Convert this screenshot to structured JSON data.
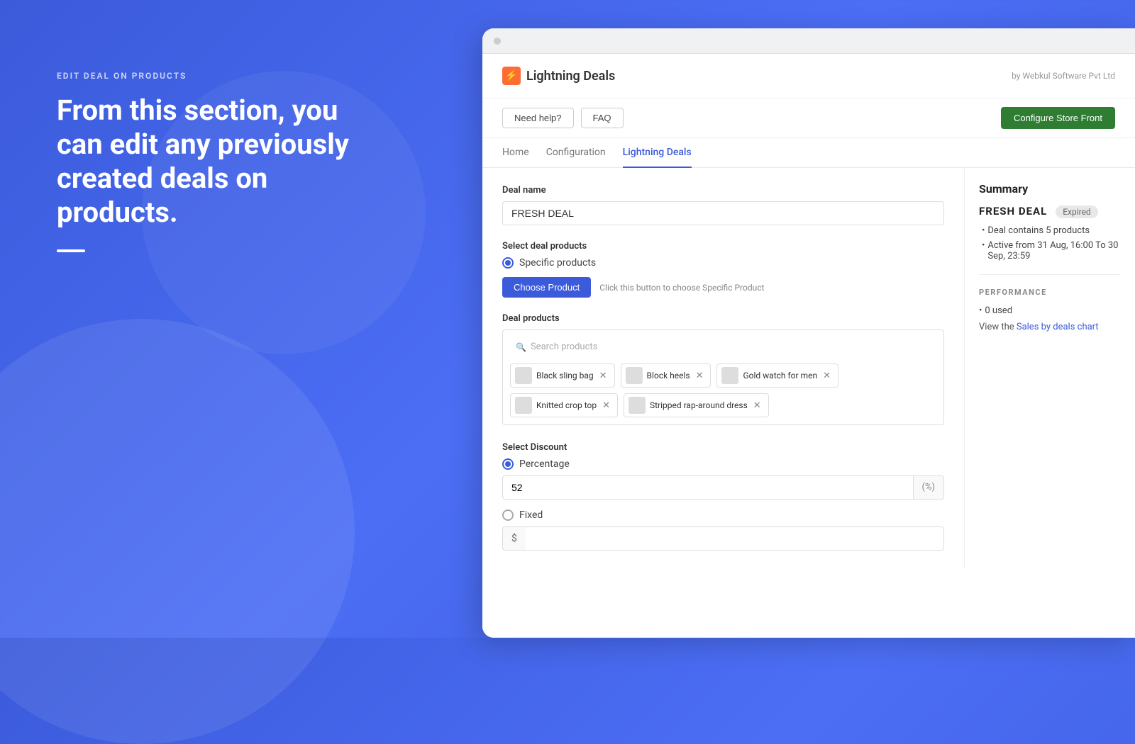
{
  "page": {
    "background": "blue-gradient"
  },
  "left_panel": {
    "section_label": "EDIT DEAL ON PRODUCTS",
    "headline": "From this section, you can edit any previously created deals on products.",
    "divider": true
  },
  "window": {
    "dot_color": "#ccc"
  },
  "app_header": {
    "logo_icon": "⚡",
    "title": "Lightning Deals",
    "vendor": "by Webkul Software Pvt Ltd"
  },
  "toolbar": {
    "need_help_label": "Need help?",
    "faq_label": "FAQ",
    "configure_label": "Configure Store Front"
  },
  "nav": {
    "tabs": [
      {
        "label": "Home",
        "active": false
      },
      {
        "label": "Configuration",
        "active": false
      },
      {
        "label": "Lightning Deals",
        "active": true
      }
    ]
  },
  "form": {
    "deal_name_label": "Deal name",
    "deal_name_value": "FRESH DEAL",
    "select_deal_products_label": "Select deal products",
    "specific_products_label": "Specific products",
    "choose_product_btn": "Choose Product",
    "choose_product_hint": "Click this button to choose Specific Product",
    "deal_products_label": "Deal products",
    "search_placeholder": "Search products",
    "products": [
      {
        "name": "Black sling bag",
        "thumb_class": "thumb-sling"
      },
      {
        "name": "Block heels",
        "thumb_class": "thumb-heels"
      },
      {
        "name": "Gold watch for men",
        "thumb_class": "thumb-watch"
      },
      {
        "name": "Knitted crop top",
        "thumb_class": "thumb-knit"
      },
      {
        "name": "Stripped rap-around dress",
        "thumb_class": "thumb-dress"
      }
    ],
    "select_discount_label": "Select Discount",
    "percentage_label": "Percentage",
    "percentage_value": "52",
    "percentage_suffix": "(%)",
    "fixed_label": "Fixed",
    "fixed_prefix": "$",
    "fixed_value": ""
  },
  "summary": {
    "title": "Summary",
    "deal_name": "FRESH DEAL",
    "badge": "Expired",
    "bullet1": "Deal contains 5 products",
    "bullet2": "Active from 31 Aug, 16:00 To 30 Sep, 23:59",
    "perf_label": "PERFORMANCE",
    "used_label": "0 used",
    "sales_text": "View the ",
    "sales_link_text": "Sales by deals chart"
  }
}
